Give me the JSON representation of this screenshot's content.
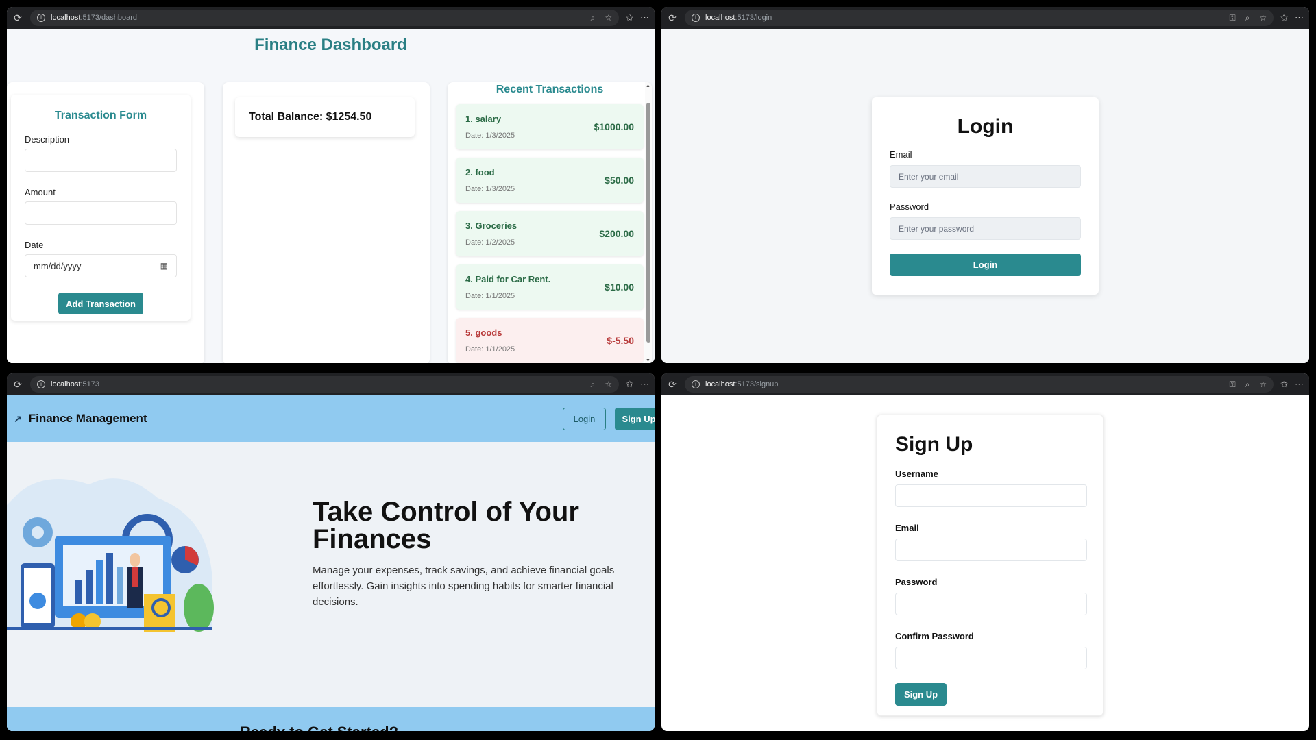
{
  "windows": {
    "dashboard": {
      "url_host": "localhost",
      "url_path": ":5173/dashboard",
      "title": "Finance Dashboard",
      "form": {
        "title": "Transaction Form",
        "description_label": "Description",
        "amount_label": "Amount",
        "date_label": "Date",
        "date_placeholder": "mm/dd/yyyy",
        "submit_label": "Add Transaction"
      },
      "balance_text": "Total Balance: $1254.50",
      "recent_title": "Recent Transactions",
      "transactions": [
        {
          "name": "1. salary",
          "date": "Date: 1/3/2025",
          "amount": "$1000.00"
        },
        {
          "name": "2. food",
          "date": "Date: 1/3/2025",
          "amount": "$50.00"
        },
        {
          "name": "3. Groceries",
          "date": "Date: 1/2/2025",
          "amount": "$200.00"
        },
        {
          "name": "4. Paid for Car Rent.",
          "date": "Date: 1/1/2025",
          "amount": "$10.00"
        },
        {
          "name": "5. goods",
          "date": "Date: 1/1/2025",
          "amount": "$-5.50"
        }
      ]
    },
    "login": {
      "url_host": "localhost",
      "url_path": ":5173/login",
      "title": "Login",
      "email_label": "Email",
      "email_placeholder": "Enter your email",
      "password_label": "Password",
      "password_placeholder": "Enter your password",
      "button_label": "Login"
    },
    "landing": {
      "url_host": "localhost",
      "url_path": ":5173",
      "brand": "Finance Management",
      "login_label": "Login",
      "signup_label": "Sign Up",
      "hero_title_line1": "Take Control of Your",
      "hero_title_line2": "Finances",
      "hero_text": "Manage your expenses, track savings, and achieve financial goals effortlessly. Gain insights into spending habits for smarter financial decisions.",
      "cta_title": "Ready to Get Started?"
    },
    "signup": {
      "url_host": "localhost",
      "url_path": ":5173/signup",
      "title": "Sign Up",
      "username_label": "Username",
      "email_label": "Email",
      "password_label": "Password",
      "confirm_label": "Confirm Password",
      "button_label": "Sign Up"
    }
  },
  "colors": {
    "teal": "#2a8a8f",
    "nav_blue": "#90caf0",
    "positive": "#2b6b46",
    "negative": "#b83a3a"
  }
}
